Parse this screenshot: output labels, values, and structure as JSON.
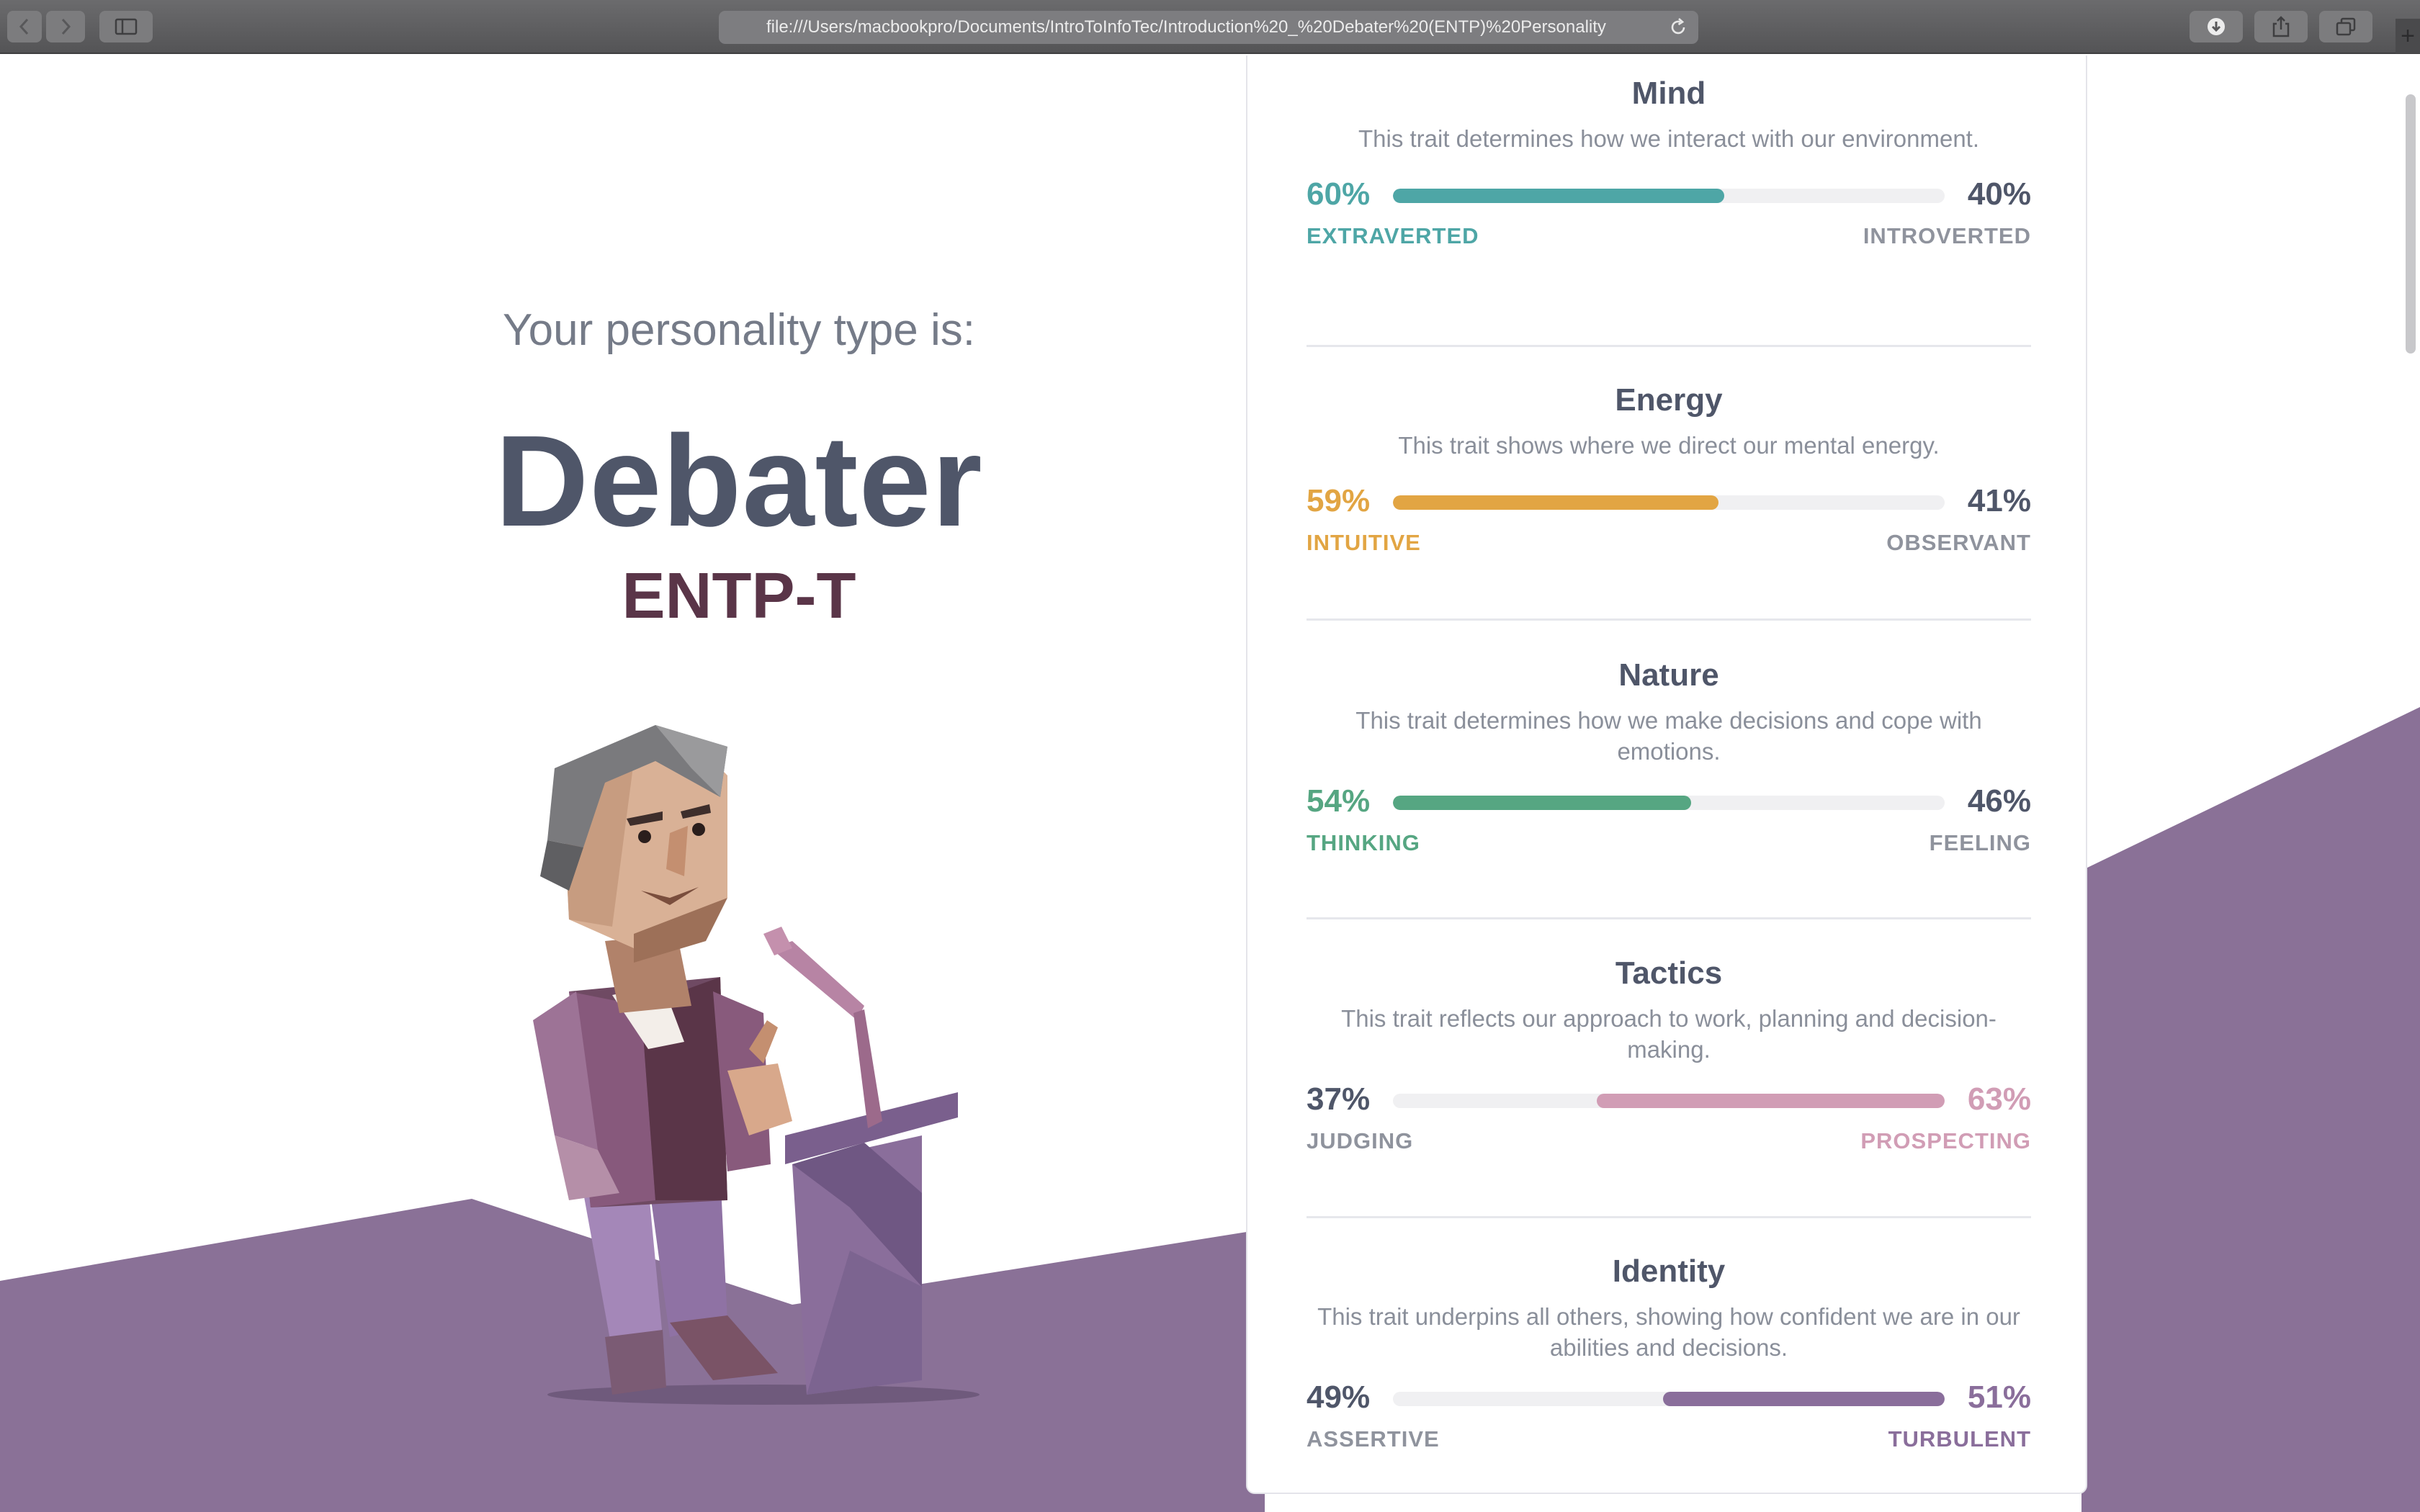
{
  "browser": {
    "url": "file:///Users/macbookpro/Documents/IntroToInfoTec/Introduction%20_%20Debater%20(ENTP)%20Personality"
  },
  "hero": {
    "type_label": "Your personality type is:",
    "type_name": "Debater",
    "type_code": "ENTP-T"
  },
  "colors": {
    "purple_bg": "#8a7197",
    "teal": "#4ea6a6",
    "gold": "#e2a543",
    "green": "#56a682",
    "pink": "#d19db5",
    "purple": "#8a6e9b",
    "neutral_text": "#4f5669",
    "muted_label": "#8f939d"
  },
  "traits": [
    {
      "title": "Mind",
      "description": "This trait determines how we interact with our environment.",
      "left_percent": "60%",
      "right_percent": "40%",
      "left_label": "EXTRAVERTED",
      "right_label": "INTROVERTED",
      "dominant": "left",
      "dominant_fraction": 0.6,
      "color": "#4ea6a6"
    },
    {
      "title": "Energy",
      "description": "This trait shows where we direct our mental energy.",
      "left_percent": "59%",
      "right_percent": "41%",
      "left_label": "INTUITIVE",
      "right_label": "OBSERVANT",
      "dominant": "left",
      "dominant_fraction": 0.59,
      "color": "#e2a543"
    },
    {
      "title": "Nature",
      "description": "This trait determines how we make decisions and cope with emotions.",
      "left_percent": "54%",
      "right_percent": "46%",
      "left_label": "THINKING",
      "right_label": "FEELING",
      "dominant": "left",
      "dominant_fraction": 0.54,
      "color": "#56a682"
    },
    {
      "title": "Tactics",
      "description": "This trait reflects our approach to work, planning and decision-making.",
      "left_percent": "37%",
      "right_percent": "63%",
      "left_label": "JUDGING",
      "right_label": "PROSPECTING",
      "dominant": "right",
      "dominant_fraction": 0.63,
      "color": "#d19db5"
    },
    {
      "title": "Identity",
      "description": "This trait underpins all others, showing how confident we are in our abilities and decisions.",
      "left_percent": "49%",
      "right_percent": "51%",
      "left_label": "ASSERTIVE",
      "right_label": "TURBULENT",
      "dominant": "right",
      "dominant_fraction": 0.51,
      "color": "#8a6e9b"
    }
  ]
}
